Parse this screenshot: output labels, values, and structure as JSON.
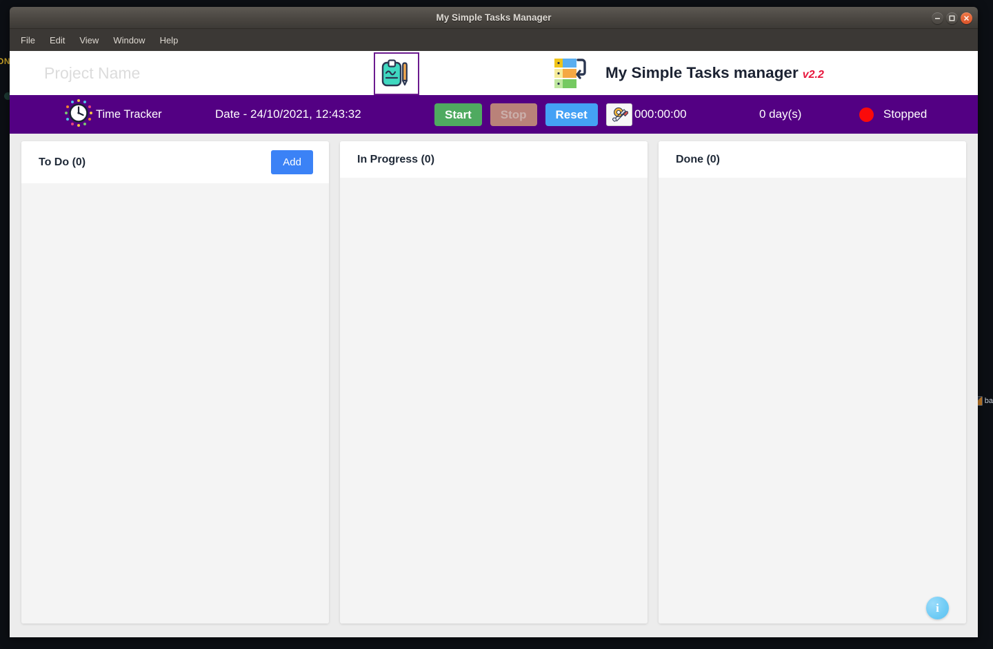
{
  "window": {
    "title": "My Simple Tasks Manager",
    "controls": {
      "minimize": "minimize-button",
      "maximize": "maximize-button",
      "close": "close-button"
    }
  },
  "menubar": {
    "items": [
      {
        "label": "File"
      },
      {
        "label": "Edit"
      },
      {
        "label": "View"
      },
      {
        "label": "Window"
      },
      {
        "label": "Help"
      }
    ]
  },
  "header": {
    "project_input": {
      "value": "",
      "placeholder": "Project Name"
    },
    "clipboard_icon": "clipboard-pencil-icon",
    "logo_icon": "tasks-logo-icon",
    "brand_title": "My Simple Tasks manager",
    "brand_version": "v2.2"
  },
  "tracker": {
    "clock_icon": "clock-icon",
    "label": "Time Tracker",
    "date": "Date - 24/10/2021, 12:43:32",
    "start_label": "Start",
    "stop_label": "Stop",
    "reset_label": "Reset",
    "settings_icon": "settings-tools-icon",
    "elapsed": "000:00:00",
    "days": "0 day(s)",
    "status_text": "Stopped",
    "status_color": "#fb0a0a",
    "bar_color": "#530083"
  },
  "board": {
    "columns": [
      {
        "title": "To Do (0)",
        "add_label": "Add",
        "has_add": true
      },
      {
        "title": "In Progress (0)",
        "has_add": false
      },
      {
        "title": "Done (0)",
        "has_add": false
      }
    ]
  },
  "info_button": {
    "icon": "info-icon",
    "glyph": "i"
  },
  "desktop": {
    "left_label": "ON",
    "right_label": "ba"
  }
}
